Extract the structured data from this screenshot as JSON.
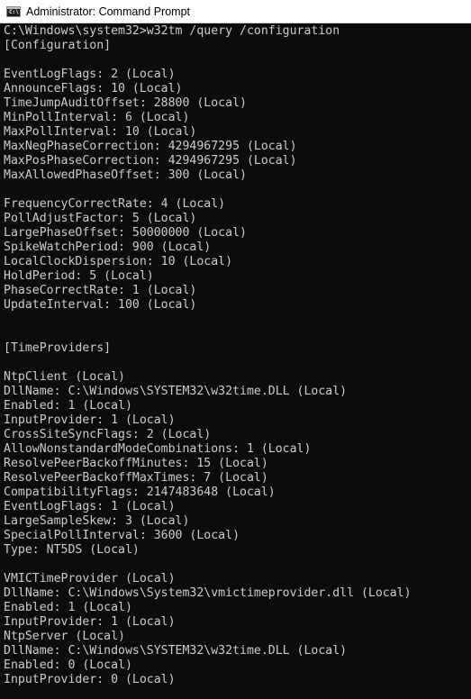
{
  "window": {
    "title": "Administrator: Command Prompt",
    "icon_glyph": "C:\\",
    "icon_name": "cmd-icon"
  },
  "console": {
    "lines": [
      "C:\\Windows\\system32>w32tm /query /configuration",
      "[Configuration]",
      "",
      "EventLogFlags: 2 (Local)",
      "AnnounceFlags: 10 (Local)",
      "TimeJumpAuditOffset: 28800 (Local)",
      "MinPollInterval: 6 (Local)",
      "MaxPollInterval: 10 (Local)",
      "MaxNegPhaseCorrection: 4294967295 (Local)",
      "MaxPosPhaseCorrection: 4294967295 (Local)",
      "MaxAllowedPhaseOffset: 300 (Local)",
      "",
      "FrequencyCorrectRate: 4 (Local)",
      "PollAdjustFactor: 5 (Local)",
      "LargePhaseOffset: 50000000 (Local)",
      "SpikeWatchPeriod: 900 (Local)",
      "LocalClockDispersion: 10 (Local)",
      "HoldPeriod: 5 (Local)",
      "PhaseCorrectRate: 1 (Local)",
      "UpdateInterval: 100 (Local)",
      "",
      "",
      "[TimeProviders]",
      "",
      "NtpClient (Local)",
      "DllName: C:\\Windows\\SYSTEM32\\w32time.DLL (Local)",
      "Enabled: 1 (Local)",
      "InputProvider: 1 (Local)",
      "CrossSiteSyncFlags: 2 (Local)",
      "AllowNonstandardModeCombinations: 1 (Local)",
      "ResolvePeerBackoffMinutes: 15 (Local)",
      "ResolvePeerBackoffMaxTimes: 7 (Local)",
      "CompatibilityFlags: 2147483648 (Local)",
      "EventLogFlags: 1 (Local)",
      "LargeSampleSkew: 3 (Local)",
      "SpecialPollInterval: 3600 (Local)",
      "Type: NT5DS (Local)",
      "",
      "VMICTimeProvider (Local)",
      "DllName: C:\\Windows\\System32\\vmictimeprovider.dll (Local)",
      "Enabled: 1 (Local)",
      "InputProvider: 1 (Local)",
      "NtpServer (Local)",
      "DllName: C:\\Windows\\SYSTEM32\\w32time.DLL (Local)",
      "Enabled: 0 (Local)",
      "InputProvider: 0 (Local)"
    ]
  },
  "colors": {
    "console_background": "#0c0c0c",
    "console_text": "#cccccc",
    "titlebar_background": "#ffffff",
    "titlebar_text": "#000000"
  }
}
